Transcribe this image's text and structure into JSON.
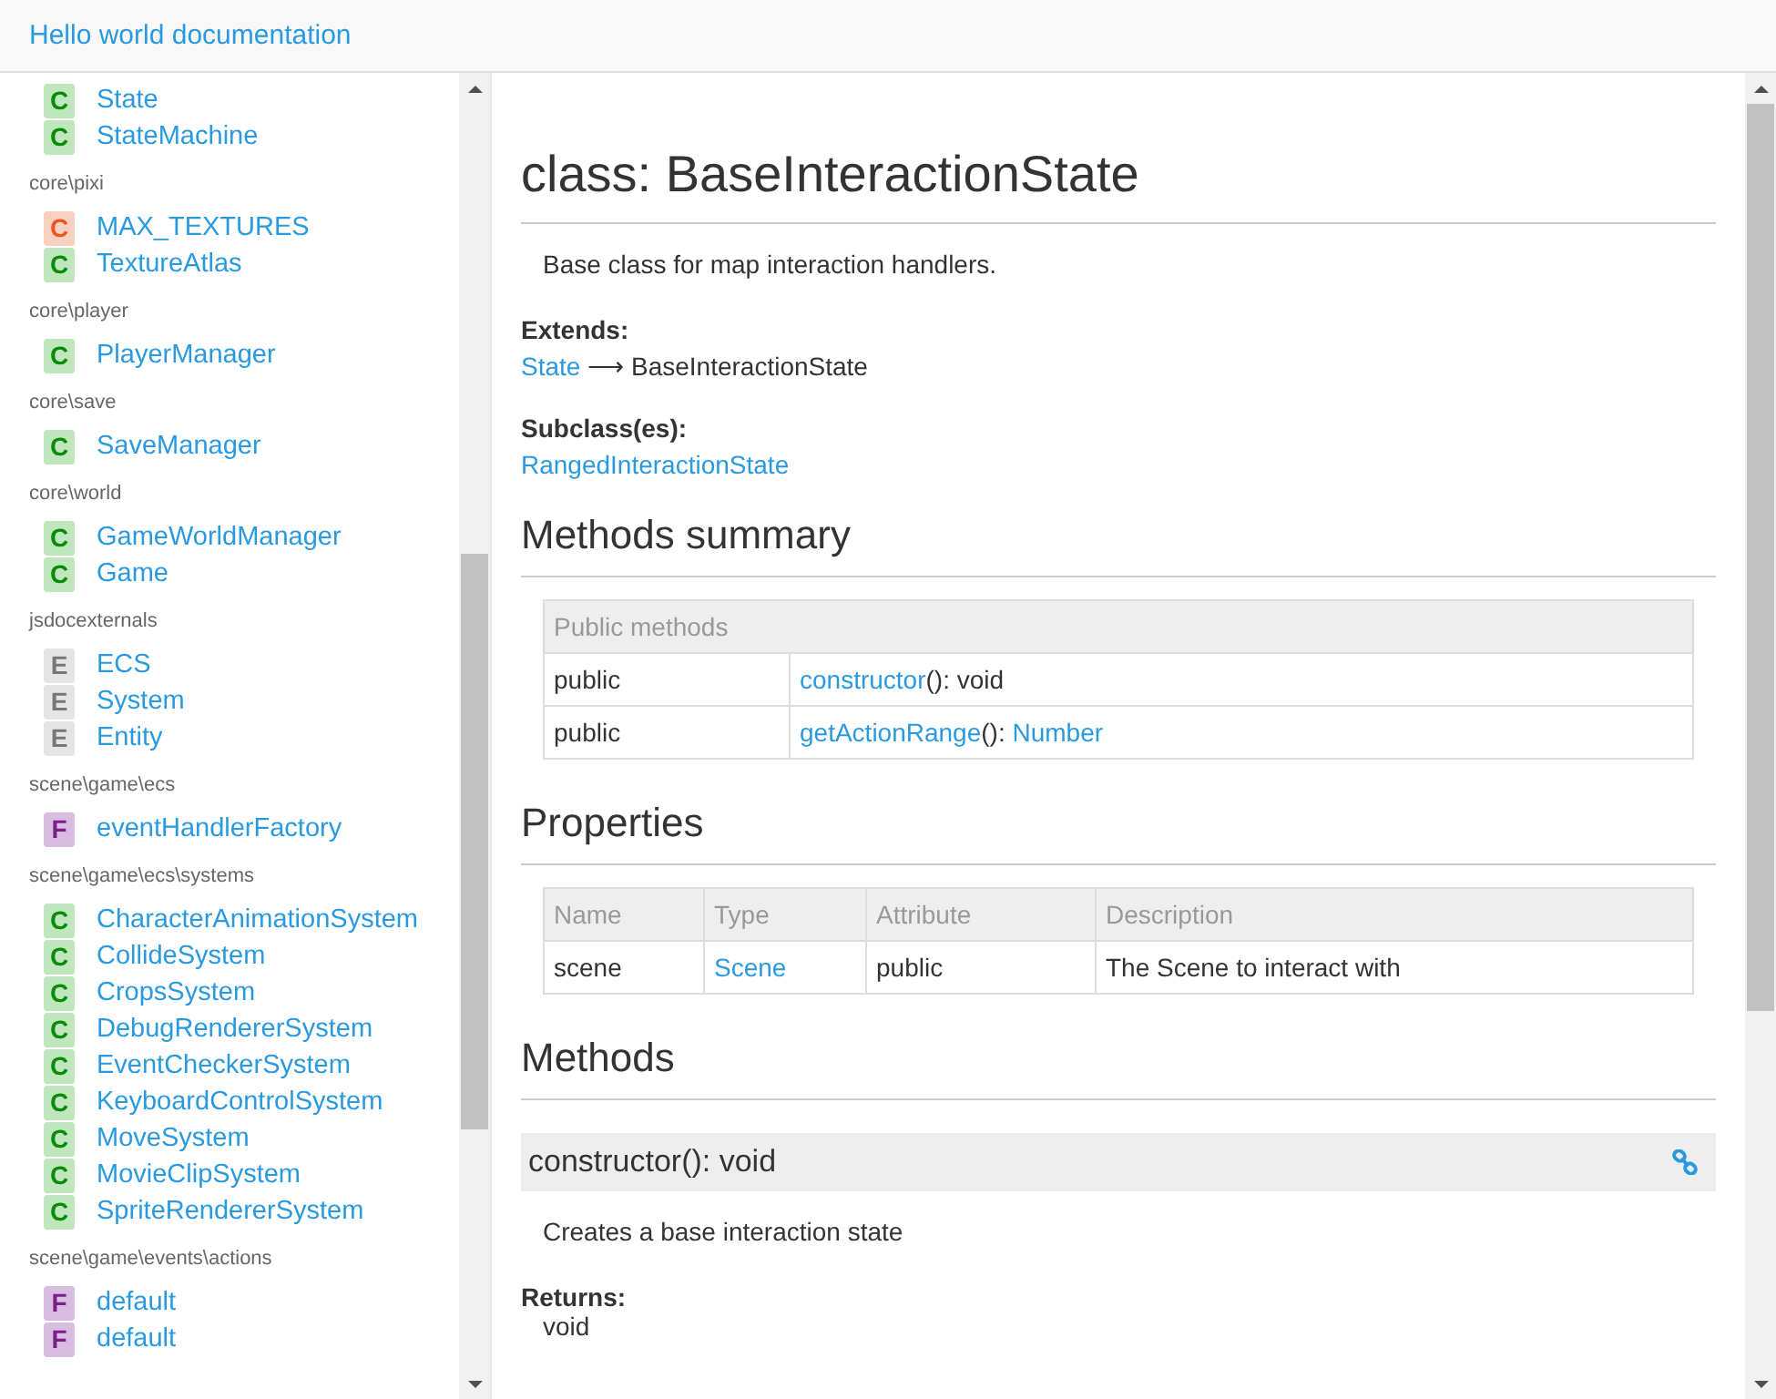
{
  "header": {
    "title": "Hello world documentation"
  },
  "sidebar": {
    "groups": [
      {
        "items": [
          {
            "kind": "class",
            "badge": "C",
            "label": "State"
          },
          {
            "kind": "class",
            "badge": "C",
            "label": "StateMachine"
          }
        ]
      },
      {
        "heading": "core\\pixi",
        "items": [
          {
            "kind": "constant",
            "badge": "C",
            "label": "MAX_TEXTURES"
          },
          {
            "kind": "class",
            "badge": "C",
            "label": "TextureAtlas"
          }
        ]
      },
      {
        "heading": "core\\player",
        "items": [
          {
            "kind": "class",
            "badge": "C",
            "label": "PlayerManager"
          }
        ]
      },
      {
        "heading": "core\\save",
        "items": [
          {
            "kind": "class",
            "badge": "C",
            "label": "SaveManager"
          }
        ]
      },
      {
        "heading": "core\\world",
        "items": [
          {
            "kind": "class",
            "badge": "C",
            "label": "GameWorldManager"
          },
          {
            "kind": "class",
            "badge": "C",
            "label": "Game"
          }
        ]
      },
      {
        "heading": "jsdocexternals",
        "items": [
          {
            "kind": "external",
            "badge": "E",
            "label": "ECS"
          },
          {
            "kind": "external",
            "badge": "E",
            "label": "System"
          },
          {
            "kind": "external",
            "badge": "E",
            "label": "Entity"
          }
        ]
      },
      {
        "heading": "scene\\game\\ecs",
        "items": [
          {
            "kind": "function",
            "badge": "F",
            "label": "eventHandlerFactory"
          }
        ]
      },
      {
        "heading": "scene\\game\\ecs\\systems",
        "items": [
          {
            "kind": "class",
            "badge": "C",
            "label": "CharacterAnimationSystem"
          },
          {
            "kind": "class",
            "badge": "C",
            "label": "CollideSystem"
          },
          {
            "kind": "class",
            "badge": "C",
            "label": "CropsSystem"
          },
          {
            "kind": "class",
            "badge": "C",
            "label": "DebugRendererSystem"
          },
          {
            "kind": "class",
            "badge": "C",
            "label": "EventCheckerSystem"
          },
          {
            "kind": "class",
            "badge": "C",
            "label": "KeyboardControlSystem"
          },
          {
            "kind": "class",
            "badge": "C",
            "label": "MoveSystem"
          },
          {
            "kind": "class",
            "badge": "C",
            "label": "MovieClipSystem"
          },
          {
            "kind": "class",
            "badge": "C",
            "label": "SpriteRendererSystem"
          }
        ]
      },
      {
        "heading": "scene\\game\\events\\actions",
        "items": [
          {
            "kind": "function",
            "badge": "F",
            "label": "default"
          },
          {
            "kind": "function",
            "badge": "F",
            "label": "default"
          }
        ]
      }
    ]
  },
  "main": {
    "title": "class: BaseInteractionState",
    "description": "Base class for map interaction handlers.",
    "extends": {
      "label": "Extends:",
      "parent": "State",
      "rest": "⟶ BaseInteractionState"
    },
    "subclasses": {
      "label": "Subclass(es):",
      "items": [
        "RangedInteractionState"
      ]
    },
    "methods_summary": {
      "heading": "Methods summary",
      "table_heading": "Public methods",
      "rows": [
        {
          "access": "public",
          "signature": [
            {
              "text": "constructor",
              "link": true
            },
            {
              "text": "(): void",
              "link": false
            }
          ]
        },
        {
          "access": "public",
          "signature": [
            {
              "text": "getActionRange",
              "link": true
            },
            {
              "text": "(): ",
              "link": false
            },
            {
              "text": "Number",
              "link": true
            }
          ]
        }
      ]
    },
    "properties": {
      "heading": "Properties",
      "columns": [
        "Name",
        "Type",
        "Attribute",
        "Description"
      ],
      "rows": [
        {
          "name": "scene",
          "type": "Scene",
          "attribute": "public",
          "description": "The Scene to interact with"
        }
      ]
    },
    "methods": {
      "heading": "Methods",
      "items": [
        {
          "signature": "constructor(): void",
          "description": "Creates a base interaction state",
          "returns_label": "Returns:",
          "returns": "void"
        }
      ]
    }
  }
}
